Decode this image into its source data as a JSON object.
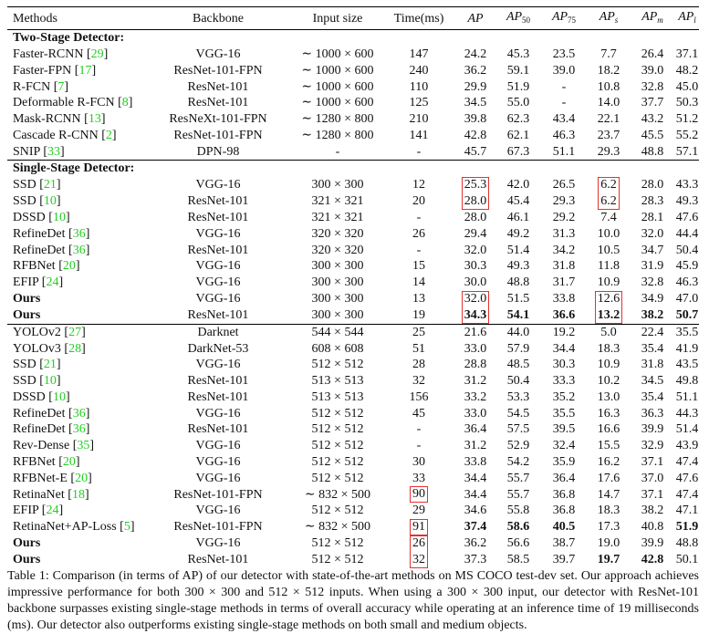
{
  "table": {
    "headers": {
      "method": "Methods",
      "backbone": "Backbone",
      "input": "Input size",
      "time": "Time(ms)",
      "ap": "AP",
      "ap50_base": "AP",
      "ap50_sub": "50",
      "ap75_base": "AP",
      "ap75_sub": "75",
      "aps_base": "AP",
      "aps_sub": "s",
      "apm_base": "AP",
      "apm_sub": "m",
      "apl_base": "AP",
      "apl_sub": "l"
    },
    "box_color": "#e53030",
    "citation_color": "#1fcf1f",
    "sections": [
      {
        "title": "Two-Stage Detector:",
        "rows": [
          {
            "method": "Faster-RCNN",
            "ref": "29",
            "backbone": "VGG-16",
            "input": "∼ 1000 × 600",
            "time": "147",
            "ap": "24.2",
            "ap50": "45.3",
            "ap75": "23.5",
            "aps": "7.7",
            "apm": "26.4",
            "apl": "37.1"
          },
          {
            "method": "Faster-FPN",
            "ref": "17",
            "backbone": "ResNet-101-FPN",
            "input": "∼ 1000 × 600",
            "time": "240",
            "ap": "36.2",
            "ap50": "59.1",
            "ap75": "39.0",
            "aps": "18.2",
            "apm": "39.0",
            "apl": "48.2"
          },
          {
            "method": "R-FCN",
            "ref": "7",
            "backbone": "ResNet-101",
            "input": "∼ 1000 × 600",
            "time": "110",
            "ap": "29.9",
            "ap50": "51.9",
            "ap75": "-",
            "aps": "10.8",
            "apm": "32.8",
            "apl": "45.0"
          },
          {
            "method": "Deformable R-FCN",
            "ref": "8",
            "backbone": "ResNet-101",
            "input": "∼ 1000 × 600",
            "time": "125",
            "ap": "34.5",
            "ap50": "55.0",
            "ap75": "-",
            "aps": "14.0",
            "apm": "37.7",
            "apl": "50.3"
          },
          {
            "method": "Mask-RCNN",
            "ref": "13",
            "backbone": "ResNeXt-101-FPN",
            "input": "∼ 1280 × 800",
            "time": "210",
            "ap": "39.8",
            "ap50": "62.3",
            "ap75": "43.4",
            "aps": "22.1",
            "apm": "43.2",
            "apl": "51.2"
          },
          {
            "method": "Cascade R-CNN",
            "ref": "2",
            "backbone": "ResNet-101-FPN",
            "input": "∼ 1280 × 800",
            "time": "141",
            "ap": "42.8",
            "ap50": "62.1",
            "ap75": "46.3",
            "aps": "23.7",
            "apm": "45.5",
            "apl": "55.2"
          },
          {
            "method": "SNIP",
            "ref": "33",
            "backbone": "DPN-98",
            "input": "-",
            "time": "-",
            "ap": "45.7",
            "ap50": "67.3",
            "ap75": "51.1",
            "aps": "29.3",
            "apm": "48.8",
            "apl": "57.1"
          }
        ]
      },
      {
        "title": "Single-Stage Detector:",
        "rows": [
          {
            "method": "SSD",
            "ref": "21",
            "backbone": "VGG-16",
            "input": "300 × 300",
            "time": "12",
            "ap": "25.3",
            "ap50": "42.0",
            "ap75": "26.5",
            "aps": "6.2",
            "apm": "28.0",
            "apl": "43.3",
            "boxed": {
              "ap": "top",
              "aps": "top"
            }
          },
          {
            "method": "SSD",
            "ref": "10",
            "backbone": "ResNet-101",
            "input": "321 × 321",
            "time": "20",
            "ap": "28.0",
            "ap50": "45.4",
            "ap75": "29.3",
            "aps": "6.2",
            "apm": "28.3",
            "apl": "49.3",
            "boxed": {
              "ap": "bottom",
              "aps": "bottom"
            }
          },
          {
            "method": "DSSD",
            "ref": "10",
            "backbone": "ResNet-101",
            "input": "321 × 321",
            "time": "-",
            "ap": "28.0",
            "ap50": "46.1",
            "ap75": "29.2",
            "aps": "7.4",
            "apm": "28.1",
            "apl": "47.6"
          },
          {
            "method": "RefineDet",
            "ref": "36",
            "backbone": "VGG-16",
            "input": "320 × 320",
            "time": "26",
            "ap": "29.4",
            "ap50": "49.2",
            "ap75": "31.3",
            "aps": "10.0",
            "apm": "32.0",
            "apl": "44.4"
          },
          {
            "method": "RefineDet",
            "ref": "36",
            "backbone": "ResNet-101",
            "input": "320 × 320",
            "time": "-",
            "ap": "32.0",
            "ap50": "51.4",
            "ap75": "34.2",
            "aps": "10.5",
            "apm": "34.7",
            "apl": "50.4"
          },
          {
            "method": "RFBNet",
            "ref": "20",
            "backbone": "VGG-16",
            "input": "300 × 300",
            "time": "15",
            "ap": "30.3",
            "ap50": "49.3",
            "ap75": "31.8",
            "aps": "11.8",
            "apm": "31.9",
            "apl": "45.9"
          },
          {
            "method": "EFIP",
            "ref": "24",
            "backbone": "VGG-16",
            "input": "300 × 300",
            "time": "14",
            "ap": "30.0",
            "ap50": "48.8",
            "ap75": "31.7",
            "aps": "10.9",
            "apm": "32.8",
            "apl": "46.3"
          },
          {
            "method": "Ours",
            "backbone": "VGG-16",
            "input": "300 × 300",
            "time": "13",
            "ap": "32.0",
            "ap50": "51.5",
            "ap75": "33.8",
            "aps": "12.6",
            "apm": "34.9",
            "apl": "47.0",
            "bold": [
              "method"
            ],
            "boxed": {
              "ap": "top",
              "aps": "top"
            }
          },
          {
            "method": "Ours",
            "backbone": "ResNet-101",
            "input": "300 × 300",
            "time": "19",
            "ap": "34.3",
            "ap50": "54.1",
            "ap75": "36.6",
            "aps": "13.2",
            "apm": "38.2",
            "apl": "50.7",
            "bold": [
              "method",
              "ap",
              "ap50",
              "ap75",
              "aps",
              "apm",
              "apl"
            ],
            "boxed": {
              "ap": "bottom",
              "aps": "bottom"
            }
          }
        ]
      },
      {
        "title": "",
        "rows": [
          {
            "method": "YOLOv2",
            "ref": "27",
            "backbone": "Darknet",
            "input": "544 × 544",
            "time": "25",
            "ap": "21.6",
            "ap50": "44.0",
            "ap75": "19.2",
            "aps": "5.0",
            "apm": "22.4",
            "apl": "35.5"
          },
          {
            "method": "YOLOv3",
            "ref": "28",
            "backbone": "DarkNet-53",
            "input": "608 × 608",
            "time": "51",
            "ap": "33.0",
            "ap50": "57.9",
            "ap75": "34.4",
            "aps": "18.3",
            "apm": "35.4",
            "apl": "41.9"
          },
          {
            "method": "SSD",
            "ref": "21",
            "backbone": "VGG-16",
            "input": "512 × 512",
            "time": "28",
            "ap": "28.8",
            "ap50": "48.5",
            "ap75": "30.3",
            "aps": "10.9",
            "apm": "31.8",
            "apl": "43.5"
          },
          {
            "method": "SSD",
            "ref": "10",
            "backbone": "ResNet-101",
            "input": "513 × 513",
            "time": "32",
            "ap": "31.2",
            "ap50": "50.4",
            "ap75": "33.3",
            "aps": "10.2",
            "apm": "34.5",
            "apl": "49.8"
          },
          {
            "method": "DSSD",
            "ref": "10",
            "backbone": "ResNet-101",
            "input": "513 × 513",
            "time": "156",
            "ap": "33.2",
            "ap50": "53.3",
            "ap75": "35.2",
            "aps": "13.0",
            "apm": "35.4",
            "apl": "51.1"
          },
          {
            "method": "RefineDet",
            "ref": "36",
            "backbone": "VGG-16",
            "input": "512 × 512",
            "time": "45",
            "ap": "33.0",
            "ap50": "54.5",
            "ap75": "35.5",
            "aps": "16.3",
            "apm": "36.3",
            "apl": "44.3"
          },
          {
            "method": "RefineDet",
            "ref": "36",
            "backbone": "ResNet-101",
            "input": "512 × 512",
            "time": "-",
            "ap": "36.4",
            "ap50": "57.5",
            "ap75": "39.5",
            "aps": "16.6",
            "apm": "39.9",
            "apl": "51.4"
          },
          {
            "method": "Rev-Dense",
            "ref": "35",
            "backbone": "VGG-16",
            "input": "512 × 512",
            "time": "-",
            "ap": "31.2",
            "ap50": "52.9",
            "ap75": "32.4",
            "aps": "15.5",
            "apm": "32.9",
            "apl": "43.9"
          },
          {
            "method": "RFBNet",
            "ref": "20",
            "backbone": "VGG-16",
            "input": "512 × 512",
            "time": "30",
            "ap": "33.8",
            "ap50": "54.2",
            "ap75": "35.9",
            "aps": "16.2",
            "apm": "37.1",
            "apl": "47.4"
          },
          {
            "method": "RFBNet-E",
            "ref": "20",
            "backbone": "VGG-16",
            "input": "512 × 512",
            "time": "33",
            "ap": "34.4",
            "ap50": "55.7",
            "ap75": "36.4",
            "aps": "17.6",
            "apm": "37.0",
            "apl": "47.6"
          },
          {
            "method": "RetinaNet",
            "ref": "18",
            "backbone": "ResNet-101-FPN",
            "input": "∼ 832 × 500",
            "time": "90",
            "ap": "34.4",
            "ap50": "55.7",
            "ap75": "36.8",
            "aps": "14.7",
            "apm": "37.1",
            "apl": "47.4",
            "boxed": {
              "time": "single"
            }
          },
          {
            "method": "EFIP",
            "ref": "24",
            "backbone": "VGG-16",
            "input": "512 × 512",
            "time": "29",
            "ap": "34.6",
            "ap50": "55.8",
            "ap75": "36.8",
            "aps": "18.3",
            "apm": "38.2",
            "apl": "47.1"
          },
          {
            "method": "RetinaNet+AP-Loss",
            "ref": "5",
            "backbone": "ResNet-101-FPN",
            "input": "∼ 832 × 500",
            "time": "91",
            "ap": "37.4",
            "ap50": "58.6",
            "ap75": "40.5",
            "aps": "17.3",
            "apm": "40.8",
            "apl": "51.9",
            "bold": [
              "ap",
              "ap50",
              "ap75",
              "apl"
            ],
            "boxed": {
              "time": "single"
            }
          },
          {
            "method": "Ours",
            "backbone": "VGG-16",
            "input": "512 × 512",
            "time": "26",
            "ap": "36.2",
            "ap50": "56.6",
            "ap75": "38.7",
            "aps": "19.0",
            "apm": "39.9",
            "apl": "48.8",
            "bold": [
              "method"
            ],
            "boxed": {
              "time": "top"
            }
          },
          {
            "method": "Ours",
            "backbone": "ResNet-101",
            "input": "512 × 512",
            "time": "32",
            "ap": "37.3",
            "ap50": "58.5",
            "ap75": "39.7",
            "aps": "19.7",
            "apm": "42.8",
            "apl": "50.1",
            "bold": [
              "method",
              "aps",
              "apm"
            ],
            "boxed": {
              "time": "bottom"
            }
          }
        ]
      }
    ]
  },
  "caption": "Table 1: Comparison (in terms of AP) of our detector with state-of-the-art methods on MS COCO test-dev set. Our approach achieves impressive performance for both 300 × 300 and 512 × 512 inputs. When using a 300 × 300 input, our detector with ResNet-101 backbone surpasses existing single-stage methods in terms of overall accuracy while operating at an inference time of 19 milliseconds (ms). Our detector also outperforms existing single-stage methods on both small and medium objects."
}
